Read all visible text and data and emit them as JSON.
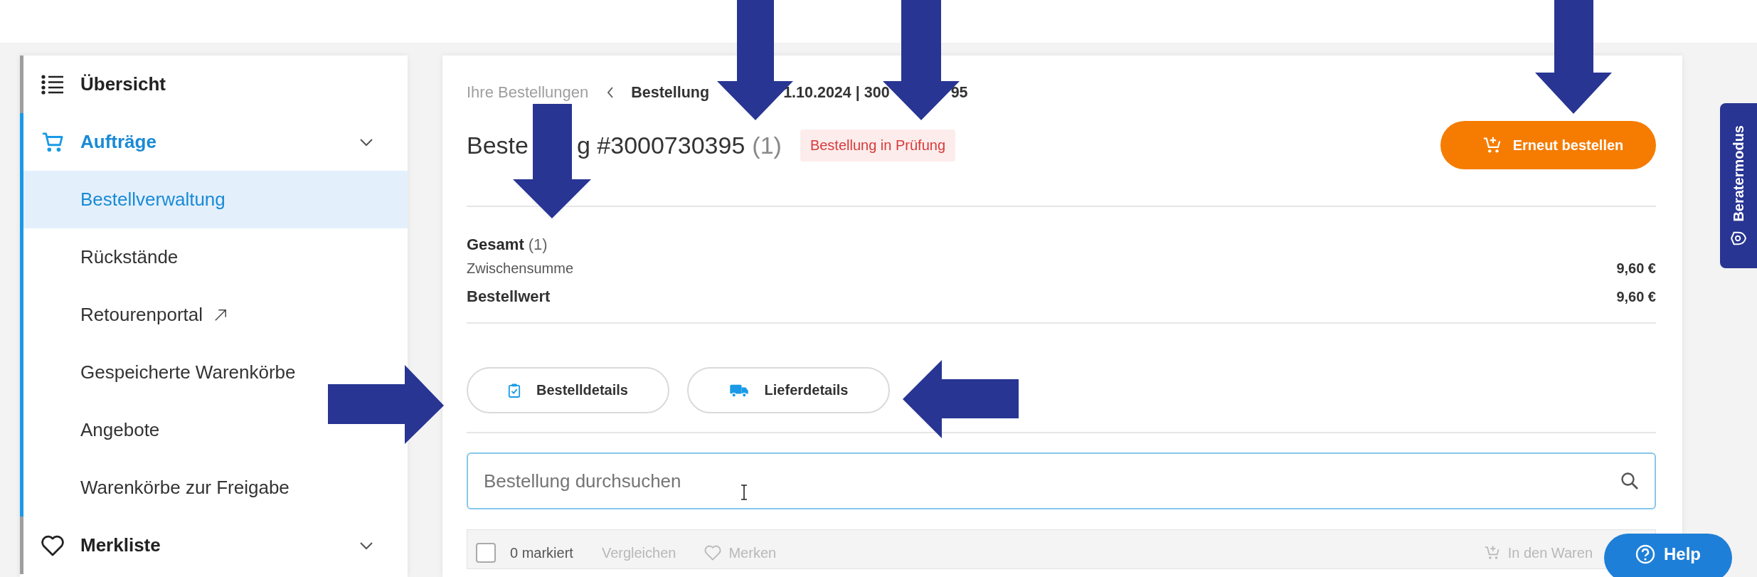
{
  "sidebar": {
    "items": [
      {
        "label": "Übersicht",
        "selected": false
      },
      {
        "label": "Aufträge",
        "selected": true,
        "children": [
          {
            "label": "Bestellverwaltung",
            "selected": true,
            "external": false
          },
          {
            "label": "Rückstände",
            "selected": false,
            "external": false
          },
          {
            "label": "Retourenportal",
            "selected": false,
            "external": true
          },
          {
            "label": "Gespeicherte Warenkörbe",
            "selected": false,
            "external": false
          },
          {
            "label": "Angebote",
            "selected": false,
            "external": false
          },
          {
            "label": "Warenkörbe zur Freigabe",
            "selected": false,
            "external": false
          }
        ]
      },
      {
        "label": "Merkliste",
        "selected": false
      }
    ]
  },
  "breadcrumb": {
    "parent": "Ihre Bestellungen",
    "current_visible_parts": [
      "Bestellung",
      "1.10.2024 | 300",
      "95"
    ]
  },
  "order": {
    "title_parts": [
      "Beste",
      "g #3000730395"
    ],
    "count": "(1)",
    "status": "Bestellung in Prüfung",
    "reorder_button": "Erneut bestellen"
  },
  "summary": {
    "heading": "Gesamt",
    "count": "(1)",
    "rows": [
      {
        "label": "Zwischensumme",
        "value": "9,60 €",
        "bold": false
      },
      {
        "label": "Bestellwert",
        "value": "9,60 €",
        "bold": true
      }
    ]
  },
  "detail_buttons": [
    "Bestelldetails",
    "Lieferdetails"
  ],
  "search": {
    "placeholder": "Bestellung durchsuchen"
  },
  "toolbar": {
    "checked": false,
    "selection_label": "0 markiert",
    "actions": [
      {
        "label": "Vergleichen",
        "disabled": true
      },
      {
        "label": "Merken",
        "disabled": true
      },
      {
        "label": "In den Waren",
        "disabled": true
      }
    ]
  },
  "side_tab": "Beratermodus",
  "help_button": "Help"
}
